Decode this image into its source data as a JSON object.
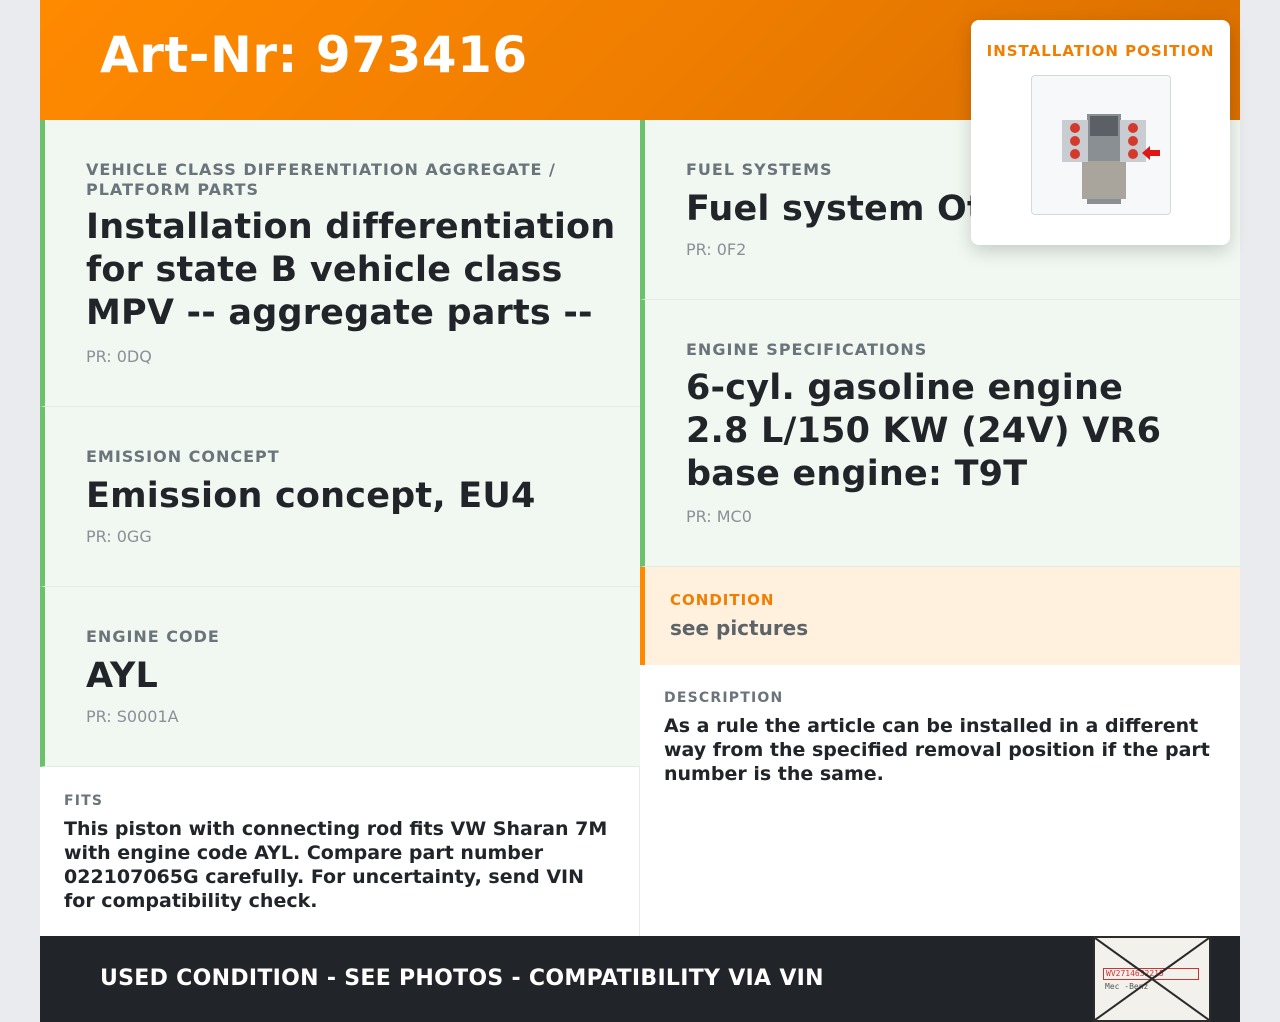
{
  "header": {
    "title": "Art-Nr: 973416"
  },
  "cards": [
    {
      "label": "VEHICLE CLASS DIFFERENTIATION AGGREGATE / PLATFORM PARTS",
      "value": "Installation differentiation for state B vehicle class MPV -- aggregate parts --",
      "pr": "PR: 0DQ"
    },
    {
      "label": "EMISSION CONCEPT",
      "value": "Emission concept, EU4",
      "pr": "PR: 0GG"
    },
    {
      "label": "ENGINE CODE",
      "value": "AYL",
      "pr": "PR: S0001A"
    },
    {
      "label": "FUEL SYSTEMS",
      "value": "Fuel system Otto",
      "pr": "PR: 0F2"
    },
    {
      "label": "ENGINE SPECIFICATIONS",
      "value": "6-cyl. gasoline engine 2.8 L/150 KW (24V) VR6 base engine: T9T",
      "pr": "PR: MC0"
    }
  ],
  "condition": {
    "label": "CONDITION",
    "value": "see pictures"
  },
  "fits": {
    "label": "FITS",
    "text": "This piston with connecting rod fits VW Sharan 7M with engine code AYL. Compare part number 022107065G carefully. For uncertainty, send VIN for compatibility check."
  },
  "description": {
    "label": "DESCRIPTION",
    "text": "As a rule the article can be installed in a different way from the specified removal position if the part number is the same."
  },
  "installation": {
    "label": "INSTALLATION POSITION",
    "image_icon": "engine-diagram-icon"
  },
  "footer": {
    "text": "USED CONDITION - SEE PHOTOS - COMPATIBILITY VIA VIN",
    "stamp_icon": "vin-document-crossed-icon",
    "stamp_plate": "WV2714632215",
    "stamp_maker": "Mec -Benz"
  },
  "colors": {
    "accent_orange": "#ff8a00",
    "green_border": "#6cc26c",
    "card_bg": "#f1f8f1",
    "footer_bg": "#212529"
  }
}
